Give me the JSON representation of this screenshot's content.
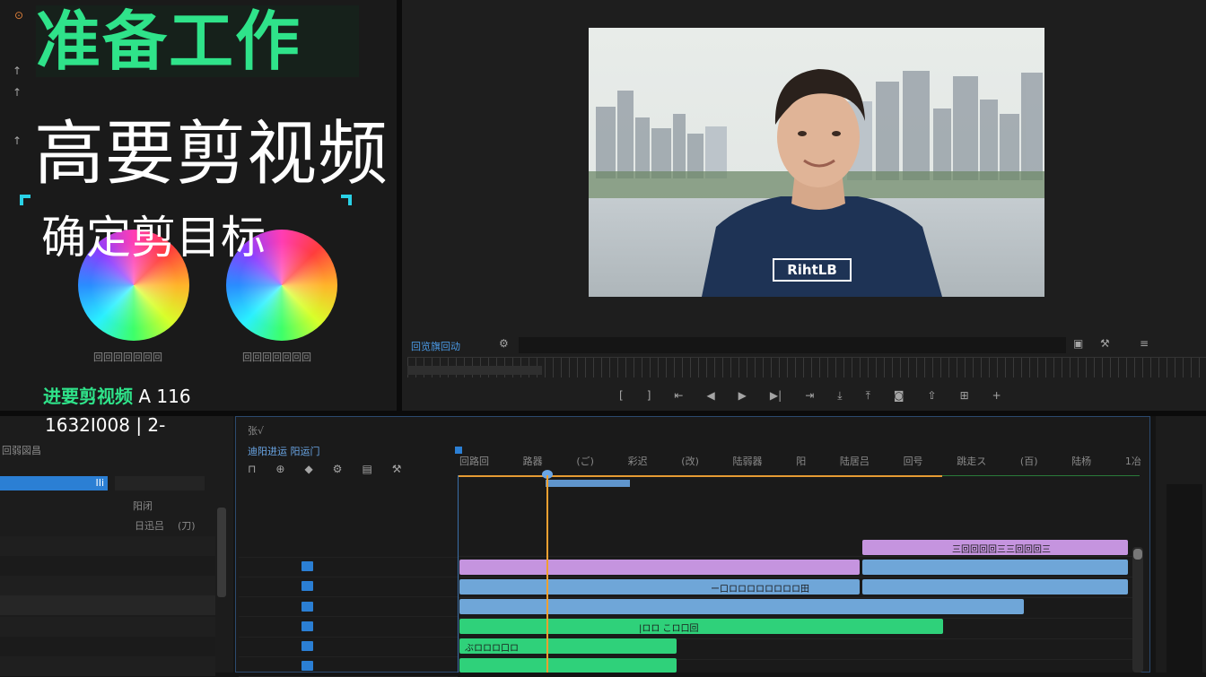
{
  "overlay": {
    "title_green": "准备工作",
    "title_big": "高要剪视频",
    "subtitle": "确定剪目标",
    "caption_line1": "进要剪视频",
    "caption_line1_value": "A 116",
    "caption_line2": "1632I008 | 2-"
  },
  "colors": {
    "accent_green": "#2fe38a",
    "clip_purple": "#c594df",
    "clip_blue": "#6fa6d8",
    "clip_green": "#2fd17a",
    "playhead": "#f0a030"
  },
  "program_monitor": {
    "tab_label": "回览旗回动",
    "shirt_text": "RihtLB"
  },
  "timeline": {
    "panel_tab": "张√",
    "header_label": "迪阳进运 阳运门",
    "ruler_labels": [
      "回路回",
      "路器",
      "(ご)",
      "彩迟",
      "(改)",
      "陆弱器",
      "阳",
      "陆居吕",
      "回号",
      "跳走ス",
      "(百)",
      "陆杨",
      "1冶"
    ],
    "clip_labels": {
      "purple_top": "三回回回回三三回回回三",
      "blue_mid": "ー口ロロロロロロロロ田",
      "green_main": "|ロロ こロ口回",
      "green_lower": "ぶロロロ口ロ"
    }
  },
  "left_panel": {
    "header": "回弱図昌",
    "tab_selected": "IIi",
    "column_labels": [
      "阳闭",
      "日迅吕",
      "(刀)"
    ]
  },
  "wheels": {
    "labels": [
      "回回回回回回回",
      "回回回回回回回"
    ]
  }
}
